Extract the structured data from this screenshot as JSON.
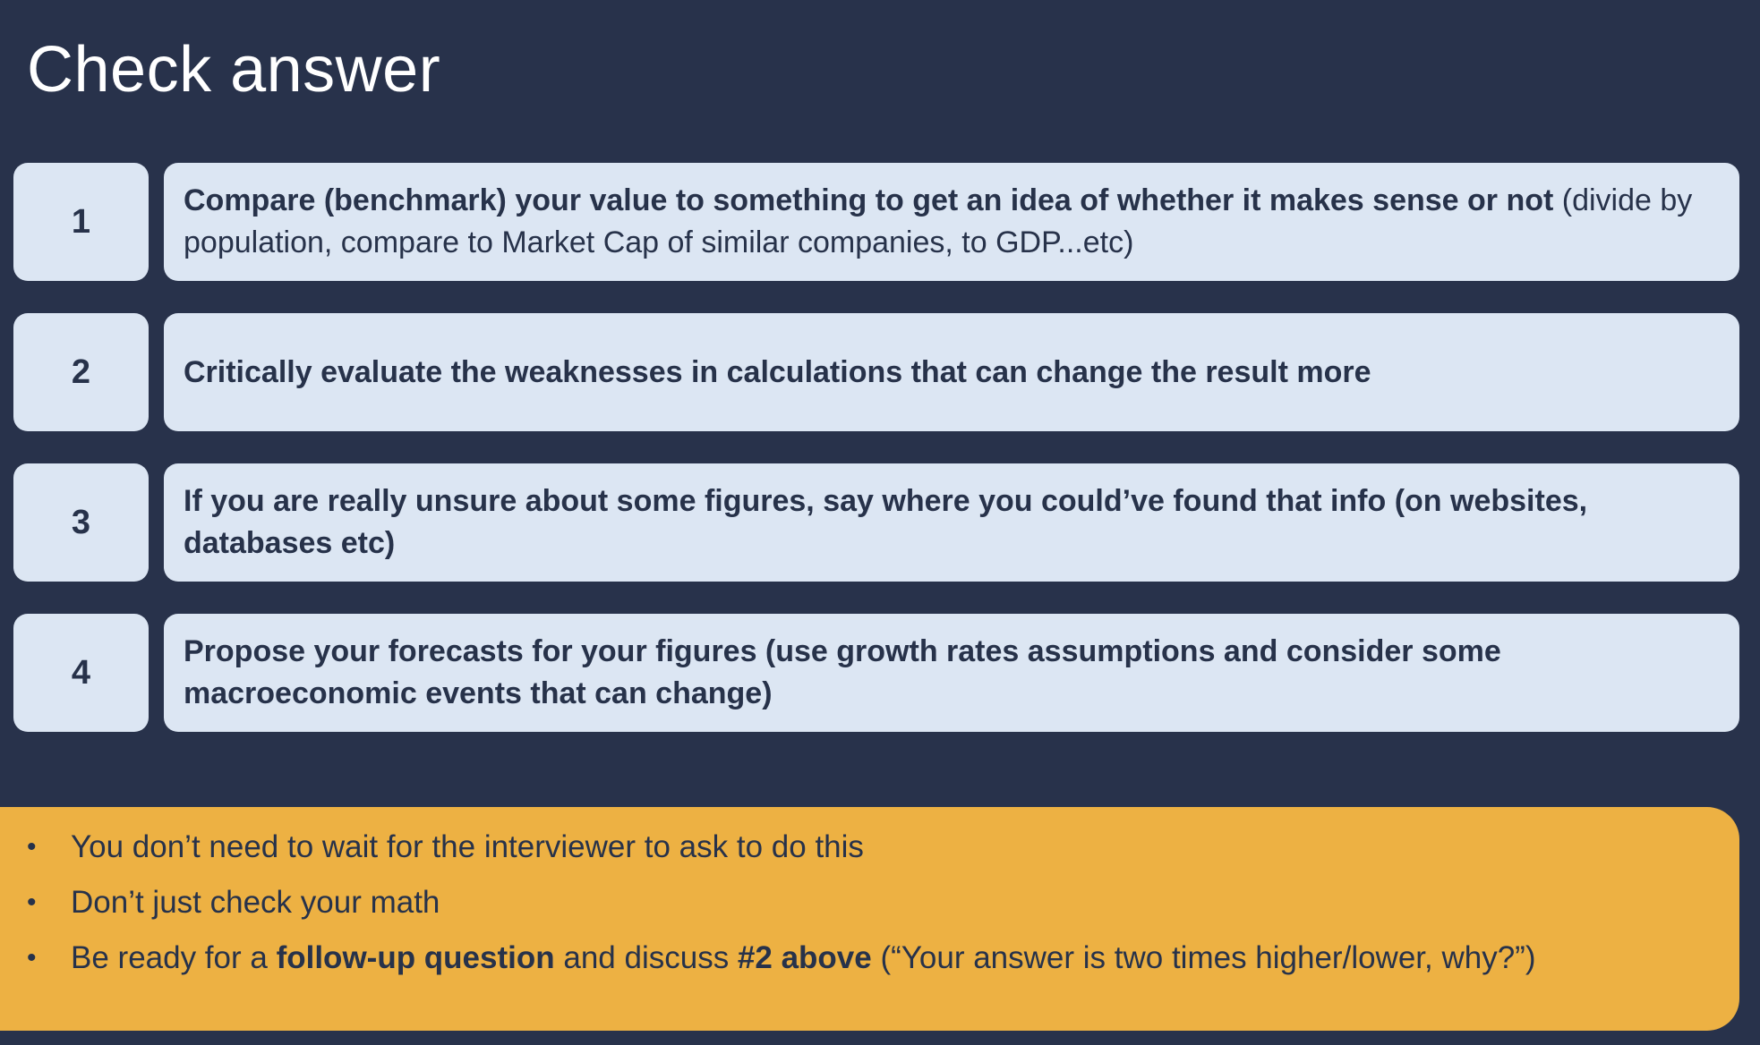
{
  "title": "Check answer",
  "steps": [
    {
      "number": "1",
      "bold": "Compare (benchmark) your value to something to get an idea of whether it makes sense or not",
      "rest": " (divide by population, compare to Market Cap of similar companies, to GDP...etc)"
    },
    {
      "number": "2",
      "bold": "Critically evaluate the weaknesses in calculations that can change the result more",
      "rest": ""
    },
    {
      "number": "3",
      "bold": "If you are really unsure about some figures, say where you could’ve found that info (on websites, databases etc)",
      "rest": ""
    },
    {
      "number": "4",
      "bold": "Propose your forecasts for your figures (use growth rates assumptions and consider some macroeconomic events that can change)",
      "rest": ""
    }
  ],
  "notes": {
    "bullet": "•",
    "item1": "You don’t need to wait for the interviewer to ask to do this",
    "item2": "Don’t just check your math",
    "item3": {
      "t1": "Be ready for a ",
      "b1": "follow-up question",
      "t2": " and discuss ",
      "b2": "#2 above",
      "t3": " (“Your answer is two times higher/lower, why?”)"
    }
  },
  "colors": {
    "background": "#28324b",
    "card": "#dce6f3",
    "note": "#edb143",
    "text_dark": "#27324a"
  }
}
